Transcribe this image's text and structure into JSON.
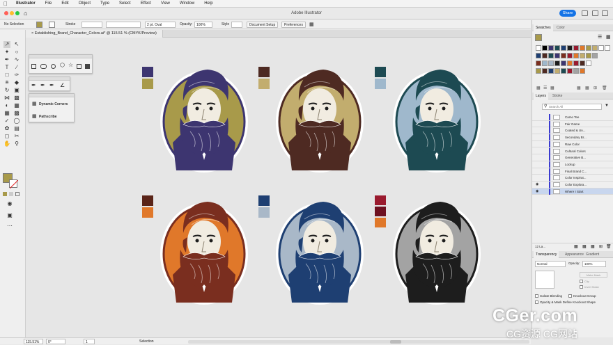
{
  "menubar": {
    "app_name": "Illustrator",
    "items": [
      "File",
      "Edit",
      "Object",
      "Type",
      "Select",
      "Effect",
      "View",
      "Window",
      "Help"
    ]
  },
  "titlebar": {
    "title": "Adobe Illustrator",
    "share_label": "Share"
  },
  "controlbar": {
    "selection": "No Selection",
    "stroke_label": "Stroke",
    "brush": "2 pt. Oval",
    "opacity_label": "Opacity:",
    "opacity_value": "100%",
    "style_label": "Style",
    "document_setup": "Document Setup",
    "preferences": "Preferences"
  },
  "document_tab": {
    "label": "Establishing_Brand_Character_Colors.ai* @ 115.51 % (CMYK/Preview)"
  },
  "float_panels": {
    "dynamic_corners": "Dynamic Corners",
    "pathscribe": "Pathscribe"
  },
  "colors": {
    "purple": "#3d3570",
    "olive": "#a89a4a",
    "maroon": "#4e2a22",
    "tan": "#c2ad6e",
    "teal": "#1d4a52",
    "lightblue": "#9fb8cc",
    "rust": "#7a2e1f",
    "orange": "#e0782a",
    "navy": "#1e3f72",
    "steel": "#a9b8c8",
    "black": "#1d1d1d",
    "gray": "#a3a3a3",
    "crimson": "#9a1a2e",
    "accent": "#1473e6"
  },
  "characters": [
    {
      "hair": "#3d3570",
      "bg": "#a89a4a",
      "swatches": [
        "#3d3570",
        "#a89a4a"
      ]
    },
    {
      "hair": "#4e2a22",
      "bg": "#c2ad6e",
      "swatches": [
        "#4e2a22",
        "#c2ad6e"
      ]
    },
    {
      "hair": "#1d4a52",
      "bg": "#9fb8cc",
      "swatches": [
        "#1d4a52",
        "#9fb8cc"
      ]
    },
    {
      "hair": "#7a2e1f",
      "bg": "#e0782a",
      "swatches": [
        "#5a2418",
        "#e0782a"
      ]
    },
    {
      "hair": "#1e3f72",
      "bg": "#a9b8c8",
      "swatches": [
        "#1e3f72",
        "#a9b8c8"
      ]
    },
    {
      "hair": "#1d1d1d",
      "bg": "#a3a3a3",
      "swatches": [
        "#9a1a2e",
        "#6e1020",
        "#e0782a"
      ]
    }
  ],
  "swatches_panel": {
    "tabs": [
      "Swatches",
      "Color"
    ],
    "rows": [
      [
        "#ffffff",
        "#000000",
        "#3d3570",
        "#1d4a52",
        "#1e3f72",
        "#1d1d1d",
        "#9a1a2e",
        "#e0782a",
        "#a89a4a",
        "#c2ad6e",
        "#ffffff",
        "#ffffff"
      ],
      [
        "#1e3f72",
        "#4e2a22",
        "#1d4a52",
        "#3d3570",
        "#7a2e1f",
        "#9a1a2e",
        "#e0782a",
        "#c2ad6e",
        "#a89a4a",
        "#a3a3a3"
      ],
      [
        "#7a2e1f",
        "#9fb8cc",
        "#a9b8c8",
        "#1d1d1d",
        "#3d3570",
        "#e0782a",
        "#9a1a2e",
        "#4e2a22",
        "#ffffff"
      ],
      [
        "#a89a4a",
        "#4e2a22",
        "#1e3f72",
        "#c2ad6e",
        "#1d4a52",
        "#9a1a2e",
        "#a3a3a3",
        "#e0782a"
      ]
    ]
  },
  "layers_panel": {
    "tabs": [
      "Layers",
      "Stroke"
    ],
    "search_placeholder": "Search All",
    "layers": [
      "Camo Tee",
      "Fair Game",
      "Coated & Un...",
      "Secondary Br...",
      "Raw Color",
      "Cultural Colors",
      "Generative B...",
      "Lockup",
      "Final Brand C...",
      "Color Inspirat...",
      "Color Explora...",
      "Where I Start"
    ],
    "footer": "12 La..."
  },
  "transparency_panel": {
    "tabs": [
      "Transparency",
      "Appearance",
      "Gradient"
    ],
    "mode": "Normal",
    "opacity_label": "Opacity:",
    "opacity_value": "100%",
    "make_mask": "Make Mask",
    "clip": "Clip",
    "invert_mask": "Invert Mask",
    "isolate": "Isolate Blending",
    "knockout": "Knockout Group",
    "opacity_mask": "Opacity & Mask Define Knockout Shape"
  },
  "statusbar": {
    "zoom": "115.51%",
    "rotation": "0°",
    "artboard": "1",
    "mode": "Selection"
  },
  "watermark": {
    "main": "CGer.com",
    "sub": "CG资源 CG网站"
  }
}
